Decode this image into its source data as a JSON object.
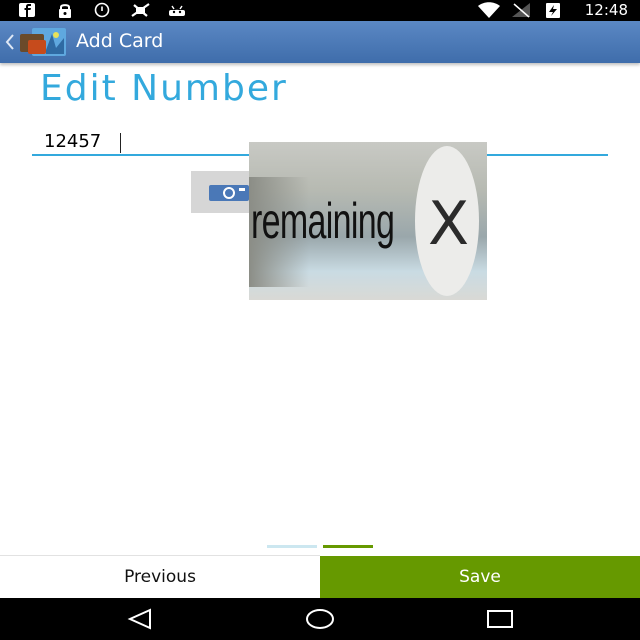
{
  "status_bar": {
    "time": "12:48",
    "icons": [
      "facebook-icon",
      "lock-icon",
      "alarm-icon",
      "no-sim-icon",
      "android-icon",
      "wifi-icon",
      "signal-icon",
      "battery-charging-icon"
    ]
  },
  "action_bar": {
    "title": "Add Card",
    "background": "#4a78b7"
  },
  "content": {
    "heading": "Edit Number",
    "number_value": "12457",
    "accent": "#33a9dd"
  },
  "ad": {
    "text": "remaining",
    "close_glyph": "X"
  },
  "pager": {
    "pages": 2,
    "current": 2,
    "active_color": "#669900",
    "inactive_color": "#cce7f0"
  },
  "footer": {
    "previous_label": "Previous",
    "save_label": "Save",
    "save_color": "#669900"
  },
  "nav_bar": {
    "buttons": [
      "back-icon",
      "home-icon",
      "recents-icon"
    ]
  }
}
